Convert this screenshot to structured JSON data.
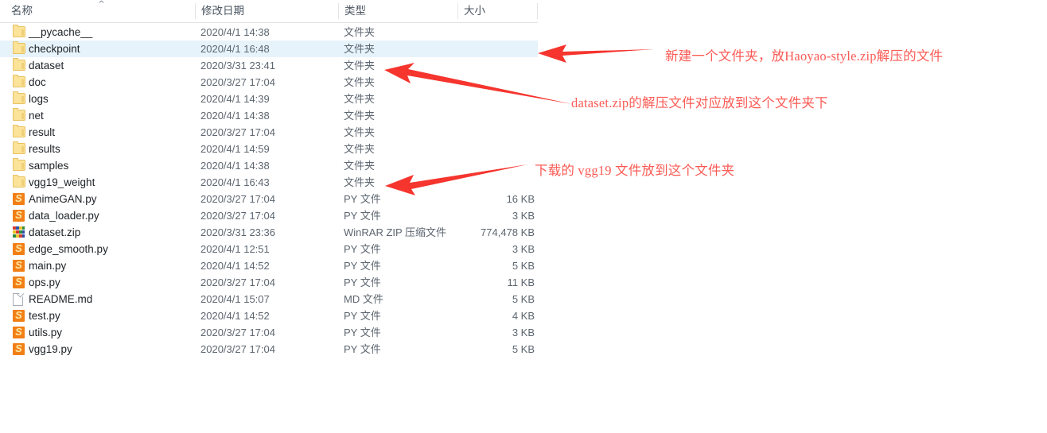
{
  "window": {
    "type": "file-explorer",
    "accent_selection_color": "#e7f3fb",
    "annotation_color": "#fb5b55"
  },
  "columns": {
    "name": "名称",
    "date_modified": "修改日期",
    "type": "类型",
    "size": "大小",
    "sort_indicator": "^"
  },
  "files": [
    {
      "name": "__pycache__",
      "date": "2020/4/1 14:38",
      "type": "文件夹",
      "size": "",
      "icon": "folder-icon",
      "selected": false
    },
    {
      "name": "checkpoint",
      "date": "2020/4/1 16:48",
      "type": "文件夹",
      "size": "",
      "icon": "folder-icon",
      "selected": true
    },
    {
      "name": "dataset",
      "date": "2020/3/31 23:41",
      "type": "文件夹",
      "size": "",
      "icon": "folder-icon",
      "selected": false
    },
    {
      "name": "doc",
      "date": "2020/3/27 17:04",
      "type": "文件夹",
      "size": "",
      "icon": "folder-icon",
      "selected": false
    },
    {
      "name": "logs",
      "date": "2020/4/1 14:39",
      "type": "文件夹",
      "size": "",
      "icon": "folder-icon",
      "selected": false
    },
    {
      "name": "net",
      "date": "2020/4/1 14:38",
      "type": "文件夹",
      "size": "",
      "icon": "folder-icon",
      "selected": false
    },
    {
      "name": "result",
      "date": "2020/3/27 17:04",
      "type": "文件夹",
      "size": "",
      "icon": "folder-icon",
      "selected": false
    },
    {
      "name": "results",
      "date": "2020/4/1 14:59",
      "type": "文件夹",
      "size": "",
      "icon": "folder-icon",
      "selected": false
    },
    {
      "name": "samples",
      "date": "2020/4/1 14:38",
      "type": "文件夹",
      "size": "",
      "icon": "folder-icon",
      "selected": false
    },
    {
      "name": "vgg19_weight",
      "date": "2020/4/1 16:43",
      "type": "文件夹",
      "size": "",
      "icon": "folder-icon",
      "selected": false
    },
    {
      "name": "AnimeGAN.py",
      "date": "2020/3/27 17:04",
      "type": "PY 文件",
      "size": "16 KB",
      "icon": "python-file-icon",
      "selected": false
    },
    {
      "name": "data_loader.py",
      "date": "2020/3/27 17:04",
      "type": "PY 文件",
      "size": "3 KB",
      "icon": "python-file-icon",
      "selected": false
    },
    {
      "name": "dataset.zip",
      "date": "2020/3/31 23:36",
      "type": "WinRAR ZIP 压缩文件",
      "size": "774,478 KB",
      "icon": "winrar-zip-icon",
      "selected": false
    },
    {
      "name": "edge_smooth.py",
      "date": "2020/4/1 12:51",
      "type": "PY 文件",
      "size": "3 KB",
      "icon": "python-file-icon",
      "selected": false
    },
    {
      "name": "main.py",
      "date": "2020/4/1 14:52",
      "type": "PY 文件",
      "size": "5 KB",
      "icon": "python-file-icon",
      "selected": false
    },
    {
      "name": "ops.py",
      "date": "2020/3/27 17:04",
      "type": "PY 文件",
      "size": "11 KB",
      "icon": "python-file-icon",
      "selected": false
    },
    {
      "name": "README.md",
      "date": "2020/4/1 15:07",
      "type": "MD 文件",
      "size": "5 KB",
      "icon": "text-document-icon",
      "selected": false
    },
    {
      "name": "test.py",
      "date": "2020/4/1 14:52",
      "type": "PY 文件",
      "size": "4 KB",
      "icon": "python-file-icon",
      "selected": false
    },
    {
      "name": "utils.py",
      "date": "2020/3/27 17:04",
      "type": "PY 文件",
      "size": "3 KB",
      "icon": "python-file-icon",
      "selected": false
    },
    {
      "name": "vgg19.py",
      "date": "2020/3/27 17:04",
      "type": "PY 文件",
      "size": "5 KB",
      "icon": "python-file-icon",
      "selected": false
    }
  ],
  "annotations": [
    {
      "id": "annotation-checkpoint",
      "text": "新建一个文件夹，放Haoyao-style.zip解压的文件",
      "target_row": "checkpoint"
    },
    {
      "id": "annotation-dataset",
      "text": "dataset.zip的解压文件对应放到这个文件夹下",
      "target_row": "dataset"
    },
    {
      "id": "annotation-vgg19",
      "text": "下载的 vgg19 文件放到这个文件夹",
      "target_row": "vgg19_weight"
    }
  ]
}
